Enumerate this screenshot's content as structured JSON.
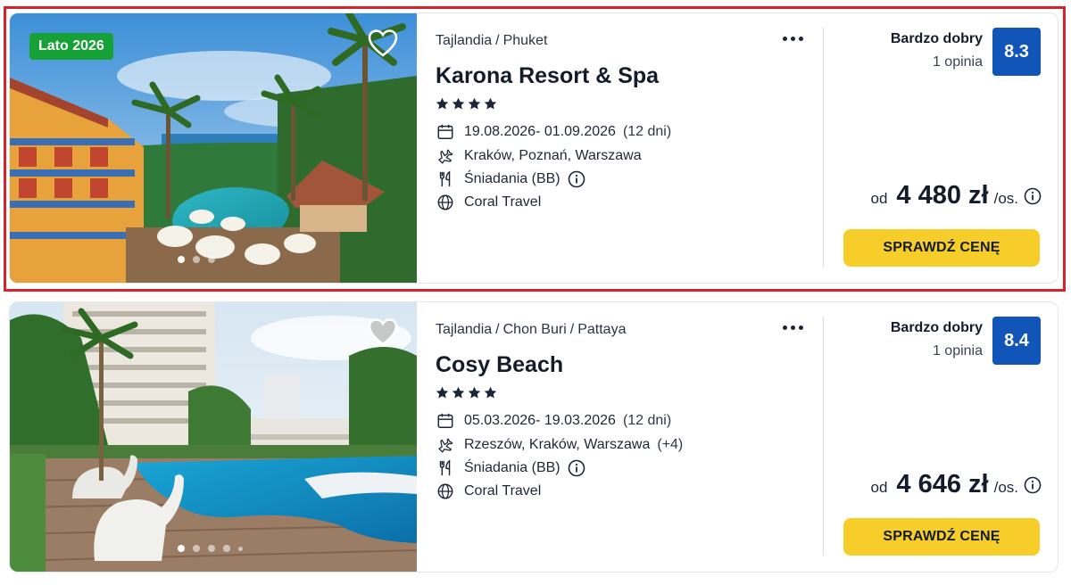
{
  "offers": [
    {
      "badge": "Lato 2026",
      "breadcrumb": [
        "Tajlandia",
        "Phuket"
      ],
      "name": "Karona Resort & Spa",
      "stars": 4,
      "dates": "19.08.2026- 01.09.2026",
      "duration": "(12 dni)",
      "departures": "Kraków, Poznań, Warszawa",
      "departures_extra": "",
      "board": "Śniadania (BB)",
      "operator": "Coral Travel",
      "rating_label": "Bardzo dobry",
      "reviews": "1 opinia",
      "score": "8.3",
      "price_prefix": "od",
      "price": "4 480 zł",
      "price_suffix": "/os.",
      "cta": "SPRAWDŹ CENĘ",
      "photo_dots": 3,
      "photo_active": 0,
      "highlighted": true
    },
    {
      "badge": "",
      "breadcrumb": [
        "Tajlandia",
        "Chon Buri",
        "Pattaya"
      ],
      "name": "Cosy Beach",
      "stars": 4,
      "dates": "05.03.2026- 19.03.2026",
      "duration": "(12 dni)",
      "departures": "Rzeszów, Kraków, Warszawa",
      "departures_extra": "(+4)",
      "board": "Śniadania (BB)",
      "operator": "Coral Travel",
      "rating_label": "Bardzo dobry",
      "reviews": "1 opinia",
      "score": "8.4",
      "price_prefix": "od",
      "price": "4 646 zł",
      "price_suffix": "/os.",
      "cta": "SPRAWDŹ CENĘ",
      "photo_dots": 5,
      "photo_active": 0,
      "highlighted": false
    }
  ],
  "icons": {
    "favorite": "heart-icon",
    "more": "more-options-icon",
    "star": "star-icon",
    "dates": "calendar-icon",
    "departures": "plane-icon",
    "board": "cutlery-icon",
    "operator": "globe-icon",
    "info": "info-icon"
  },
  "colors": {
    "badge": "#15a135",
    "score": "#1155b8",
    "cta": "#f7cd2a",
    "highlight": "#d9212c"
  }
}
